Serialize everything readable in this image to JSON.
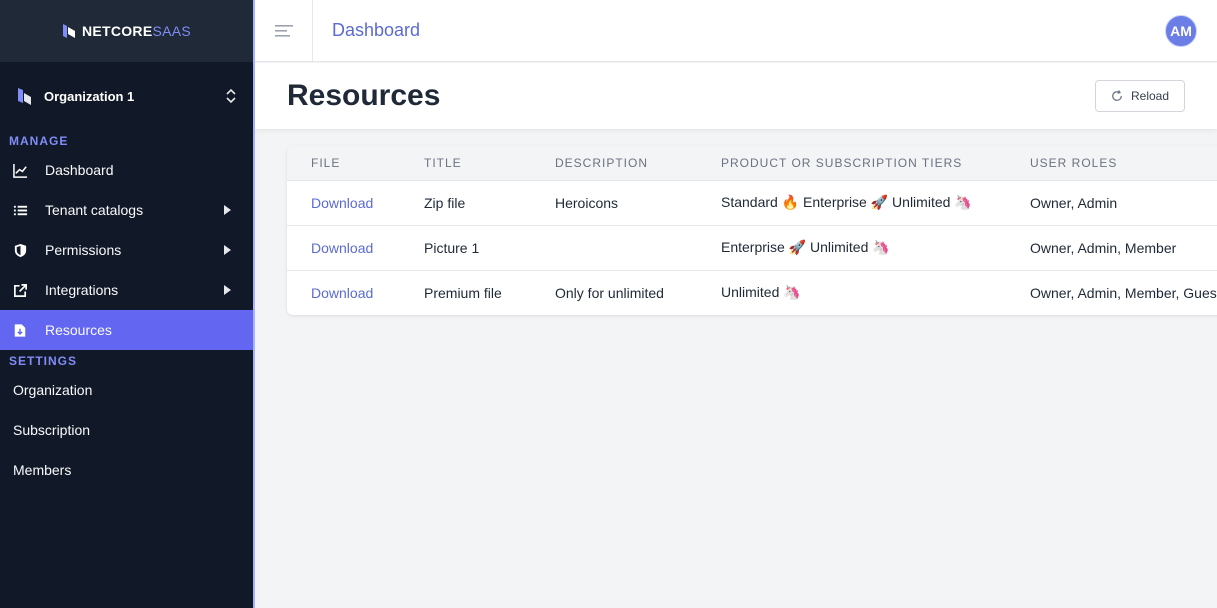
{
  "brand": {
    "part1": "NETCORE",
    "part2": "SAAS"
  },
  "org_switcher": {
    "name": "Organization 1"
  },
  "sidebar": {
    "manage_label": "MANAGE",
    "manage_items": [
      {
        "label": "Dashboard",
        "icon": "chart-icon"
      },
      {
        "label": "Tenant catalogs",
        "icon": "list-icon"
      },
      {
        "label": "Permissions",
        "icon": "shield-icon"
      },
      {
        "label": "Integrations",
        "icon": "external-link-icon"
      },
      {
        "label": "Resources",
        "icon": "document-download-icon"
      }
    ],
    "settings_label": "SETTINGS",
    "settings_items": [
      {
        "label": "Organization"
      },
      {
        "label": "Subscription"
      },
      {
        "label": "Members"
      }
    ]
  },
  "topbar": {
    "breadcrumb": "Dashboard",
    "avatar_initials": "AM"
  },
  "header": {
    "title": "Resources",
    "reload_label": "Reload"
  },
  "table": {
    "columns": [
      "FILE",
      "TITLE",
      "DESCRIPTION",
      "PRODUCT OR SUBSCRIPTION TIERS",
      "USER ROLES"
    ],
    "rows": [
      {
        "file": "Download",
        "title": "Zip file",
        "description": "Heroicons",
        "tiers": "Standard 🔥 Enterprise 🚀 Unlimited 🦄",
        "roles": "Owner, Admin"
      },
      {
        "file": "Download",
        "title": "Picture 1",
        "description": "",
        "tiers": "Enterprise 🚀 Unlimited 🦄",
        "roles": "Owner, Admin, Member"
      },
      {
        "file": "Download",
        "title": "Premium file",
        "description": "Only for unlimited",
        "tiers": "Unlimited 🦄",
        "roles": "Owner, Admin, Member, Guest"
      }
    ]
  },
  "colors": {
    "sidebar_bg": "#111827",
    "accent": "#6366f1",
    "link": "#5b6bd1"
  }
}
